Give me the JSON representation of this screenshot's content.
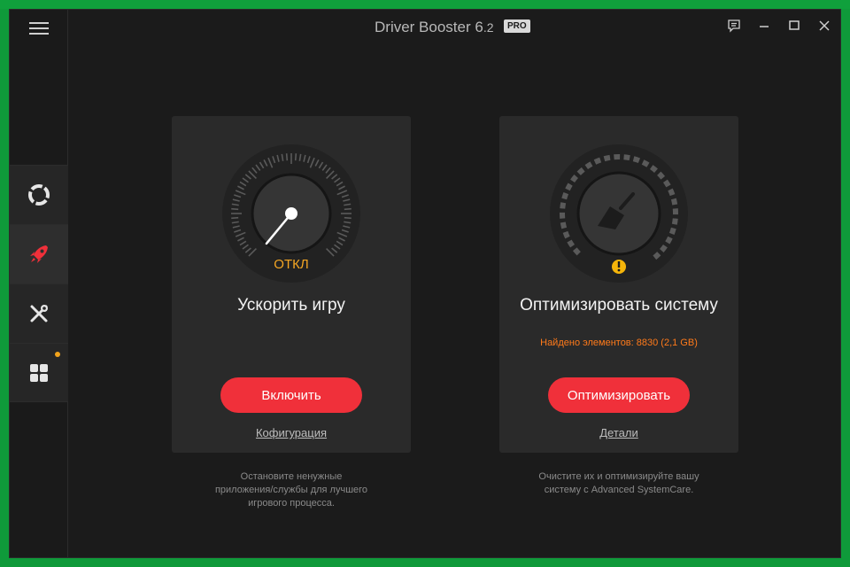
{
  "window": {
    "title": "Driver Booster 6",
    "version": ".2",
    "badge": "PRO"
  },
  "colors": {
    "accent_red": "#f0303a",
    "warning_orange": "#ff7a1a",
    "gauge_orange": "#f5a623",
    "background": "#1b1b1b",
    "card": "#2a2a2a"
  },
  "sidebar": {
    "menu_icon": "hamburger-icon",
    "items": [
      {
        "id": "scan",
        "icon": "lifebuoy-icon",
        "active": false,
        "badge": false
      },
      {
        "id": "boost",
        "icon": "rocket-icon",
        "active": true,
        "badge": false
      },
      {
        "id": "tools",
        "icon": "tools-icon",
        "active": false,
        "badge": false
      },
      {
        "id": "action-center",
        "icon": "grid-icon",
        "active": false,
        "badge": true
      }
    ]
  },
  "window_controls": [
    "feedback-icon",
    "minimize-icon",
    "maximize-icon",
    "close-icon"
  ],
  "game_boost": {
    "gauge_status": "ОТКЛ",
    "title": "Ускорить игру",
    "button": "Включить",
    "link": "Кофигурация",
    "description": [
      "Остановите ненужные",
      "приложения/службы для лучшего",
      "игрового процесса."
    ]
  },
  "optimize": {
    "title": "Оптимизировать систему",
    "found": "Найдено элементов: 8830 (2,1 GB)",
    "button": "Оптимизировать",
    "link": "Детали",
    "description": [
      "Очистите их и оптимизируйте вашу",
      "систему с Advanced SystemCare."
    ]
  }
}
